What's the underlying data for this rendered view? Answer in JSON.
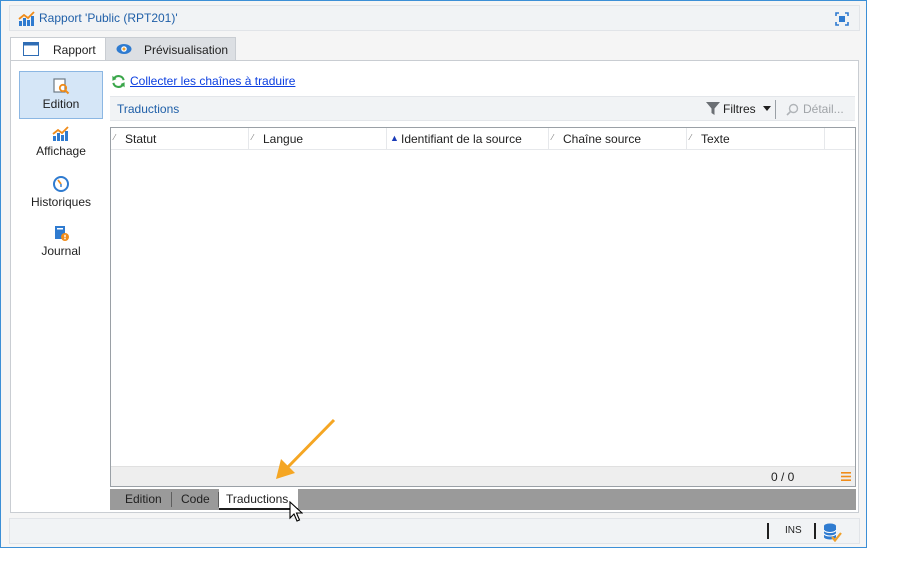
{
  "window": {
    "title": "Rapport 'Public (RPT201)'",
    "title_icon": "report-chart-icon",
    "maximize_icon": "maximize-icon"
  },
  "main_tabs": [
    {
      "label": "Rapport",
      "icon": "window-icon",
      "active": true
    },
    {
      "label": "Prévisualisation",
      "icon": "eye-icon",
      "active": false
    }
  ],
  "sidebar": {
    "items": [
      {
        "label": "Edition",
        "icon": "edit-search-icon",
        "active": true
      },
      {
        "label": "Affichage",
        "icon": "chart-icon",
        "active": false
      },
      {
        "label": "Historiques",
        "icon": "history-icon",
        "active": false
      },
      {
        "label": "Journal",
        "icon": "journal-icon",
        "active": false
      }
    ]
  },
  "actions": {
    "collect_label": "Collecter les chaînes à traduire",
    "collect_icon": "refresh-icon"
  },
  "toolbar": {
    "title": "Traductions",
    "filters_label": "Filtres",
    "detail_label": "Détail..."
  },
  "grid": {
    "columns": [
      {
        "label": "Statut",
        "sort": "none"
      },
      {
        "label": "Langue",
        "sort": "none"
      },
      {
        "label": "Identifiant de la source",
        "sort": "ascending"
      },
      {
        "label": "Chaîne source",
        "sort": "none"
      },
      {
        "label": "Texte",
        "sort": "none"
      }
    ],
    "rows": [],
    "count": "0 / 0"
  },
  "sub_tabs": [
    {
      "label": "Edition",
      "active": false
    },
    {
      "label": "Code",
      "active": false
    },
    {
      "label": "Traductions",
      "active": true
    }
  ],
  "statusbar": {
    "ins_label": "INS",
    "db_icon": "database-icon"
  },
  "colors": {
    "accent": "#1f5fa8",
    "link": "#0b3ee0",
    "arrow": "#f5a623",
    "window_border": "#3c8fd6"
  }
}
